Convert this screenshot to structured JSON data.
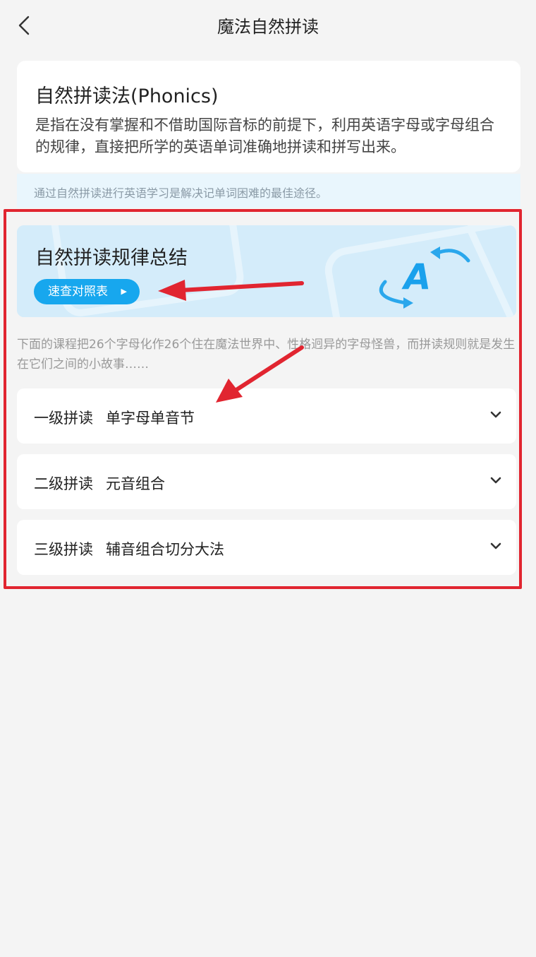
{
  "header": {
    "title": "魔法自然拼读",
    "back_icon": "chevron-left-icon"
  },
  "intro": {
    "title": "自然拼读法(Phonics)",
    "text": "是指在没有掌握和不借助国际音标的前提下，利用英语字母或字母组合的规律，直接把所学的英语单词准确地拼读和拼写出来。"
  },
  "tip": "通过自然拼读进行英语学习是解决记单词困难的最佳途径。",
  "banner": {
    "title": "自然拼读规律总结",
    "button_label": "速查对照表",
    "button_icon": "play-triangle-icon",
    "logo_letter": "A"
  },
  "description": "下面的课程把26个字母化作26个住在魔法世界中、性格迥异的字母怪兽，而拼读规则就是发生在它们之间的小故事……",
  "levels": [
    {
      "level": "一级拼读",
      "name": "单字母单音节"
    },
    {
      "level": "二级拼读",
      "name": "元音组合"
    },
    {
      "level": "三级拼读",
      "name": "辅音组合切分大法"
    }
  ],
  "colors": {
    "accent": "#17a7ee",
    "annotation": "#e12530",
    "banner_bg": "#d4ecfa",
    "page_bg": "#f4f4f4"
  }
}
